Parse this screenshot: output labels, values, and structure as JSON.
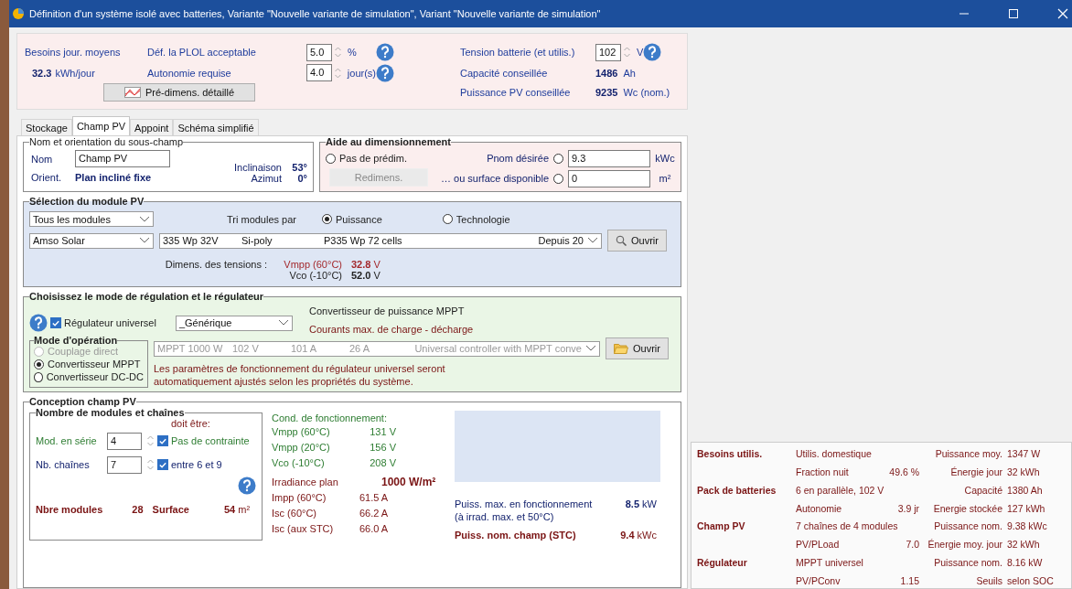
{
  "window": {
    "title": "Définition d'un système isolé avec batteries, Variante  \"Nouvelle variante de simulation\", Variant  \"Nouvelle variante de simulation\""
  },
  "needs": {
    "label": "Besoins jour. moyens",
    "value": "32.3",
    "unit": "kWh/jour"
  },
  "plol": {
    "label": "Déf. la PLOL acceptable",
    "value": "5.0",
    "unit": "%"
  },
  "autonomy": {
    "label": "Autonomie requise",
    "value": "4.0",
    "unit": "jour(s)"
  },
  "predim_button": "Pré-dimens. détaillé",
  "battery_voltage": {
    "label": "Tension batterie (et utilis.)",
    "value": "102",
    "unit": "V"
  },
  "capacity": {
    "label": "Capacité conseillée",
    "value": "1486",
    "unit": "Ah"
  },
  "pv_power": {
    "label": "Puissance PV conseillée",
    "value": "9235",
    "unit": "Wc (nom.)"
  },
  "tabs": [
    {
      "label": "Stockage",
      "selected": false
    },
    {
      "label": "Champ PV",
      "selected": true
    },
    {
      "label": "Appoint",
      "selected": false
    },
    {
      "label": "Schéma simplifié",
      "selected": false
    }
  ],
  "subfield": {
    "legend": "Nom et orientation du sous-champ",
    "name_label": "Nom",
    "name_value": "Champ PV",
    "orient_label": "Orient.",
    "orient_value": "Plan incliné fixe",
    "tilt_label": "Inclinaison",
    "tilt_value": "53°",
    "azimuth_label": "Azimut",
    "azimuth_value": "0°"
  },
  "sizing_aid": {
    "legend": "Aide au dimensionnement",
    "none_option": {
      "label": "Pas de prédim.",
      "selected": false
    },
    "button": {
      "label": "Redimens.",
      "disabled": true
    },
    "options": [
      {
        "label": "Pnom désirée",
        "selected": false,
        "value": "9.3",
        "unit": "kWc"
      },
      {
        "label": "… ou surface disponible",
        "selected": false,
        "value": "0",
        "unit": "m²"
      }
    ]
  },
  "module_selection": {
    "legend": "Sélection du module PV",
    "filter": "Tous les modules",
    "sort_label": "Tri modules par",
    "sort_options": [
      {
        "label": "Puissance",
        "selected": true
      },
      {
        "label": "Technologie",
        "selected": false
      }
    ],
    "manufacturer": "Amso Solar",
    "module": [
      "335 Wp 32V",
      "Si-poly",
      "P335 Wp  72 cells",
      "Depuis 20"
    ],
    "open_button": "Ouvrir",
    "voltage_label": "Dimens. des tensions :",
    "vmpp_label": "Vmpp (60°C)",
    "vmpp_value": "32.8",
    "vmpp_unit": "V",
    "voc_label": "Vco (-10°C)",
    "voc_value": "52.0",
    "voc_unit": "V"
  },
  "regulator": {
    "legend": "Choisissez le mode de régulation et le régulateur",
    "universal": {
      "label": "Régulateur universel",
      "checked": true
    },
    "brand": "_Générique",
    "converter_label": "Convertisseur de puissance MPPT",
    "currents_label": "Courants max. de charge - décharge",
    "mode_legend": "Mode d'opération",
    "modes": [
      {
        "label": "Couplage direct",
        "selected": false,
        "disabled": true
      },
      {
        "label": "Convertisseur MPPT",
        "selected": true,
        "disabled": false
      },
      {
        "label": "Convertisseur DC-DC",
        "selected": false,
        "disabled": false
      }
    ],
    "model": {
      "disabled": true,
      "parts": [
        "MPPT 1000 W",
        "102 V",
        "101 A",
        "26 A",
        "Universal controller with MPPT conve"
      ]
    },
    "open_button": "Ouvrir",
    "note_lines": [
      "Les paramètres de fonctionnement du régulateur universel seront",
      "automatiquement ajustés selon les propriétés du système."
    ]
  },
  "design": {
    "legend": "Conception champ PV",
    "strings_legend": "Nombre de modules et chaînes",
    "must_be": "doit être:",
    "inputs": [
      {
        "label": "Mod. en série",
        "value": "4",
        "constraint": "Pas de contrainte",
        "checked": true
      },
      {
        "label": "Nb. chaînes",
        "value": "7",
        "constraint": "entre 6 et 9",
        "checked": true
      }
    ],
    "modules_label": "Nbre modules",
    "modules_value": "28",
    "surface_label": "Surface",
    "surface_value": "54",
    "surface_unit": "m²",
    "conditions_title": "Cond. de fonctionnement:",
    "conditions": [
      {
        "label": "Vmpp (60°C)",
        "value": "131 V"
      },
      {
        "label": "Vmpp (20°C)",
        "value": "156 V"
      },
      {
        "label": "Vco (-10°C)",
        "value": "208 V"
      }
    ],
    "irradiance_label": "Irradiance plan",
    "irradiance_value": "1000  W/m²",
    "currents": [
      {
        "label": "Impp (60°C)",
        "value": "61.5 A"
      },
      {
        "label": "Isc (60°C)",
        "value": "66.2 A"
      },
      {
        "label": "Isc (aux STC)",
        "value": "66.0 A"
      }
    ],
    "max_power_label": "Puiss. max. en fonctionnement",
    "max_power_note": "(à irrad. max. et 50°C)",
    "max_power_value": "8.5",
    "max_power_unit": "kW",
    "nominal_label": "Puiss. nom. champ (STC)",
    "nominal_value": "9.4",
    "nominal_unit": "kWc"
  },
  "summary": [
    {
      "heading": "Besoins utilis.",
      "item": "Utilis. domestique",
      "label": "Puissance moy.",
      "value": "1347 W"
    },
    {
      "item": "Fraction nuit",
      "item_value": "49.6 %",
      "label": "Énergie jour",
      "value": "32 kWh"
    },
    {
      "heading": "Pack de batteries",
      "item": "6 en parallèle, 102 V",
      "label": "Capacité",
      "value": "1380 Ah"
    },
    {
      "item": "Autonomie",
      "item_value": "3.9 jr",
      "label": "Energie stockée",
      "value": "127 kWh"
    },
    {
      "heading": "Champ PV",
      "item": "7 chaînes de 4 modules",
      "label": "Puissance nom.",
      "value": "9.38 kWc"
    },
    {
      "item": "PV/PLoad",
      "item_value": "7.0",
      "label": "Énergie moy. jour",
      "value": "32 kWh"
    },
    {
      "heading": "Régulateur",
      "item": "MPPT universel",
      "label": "Puissance nom.",
      "value": "8.16 kW"
    },
    {
      "item": "PV/PConv",
      "item_value": "1.15",
      "label": "Seuils",
      "value": "selon SOC"
    }
  ]
}
